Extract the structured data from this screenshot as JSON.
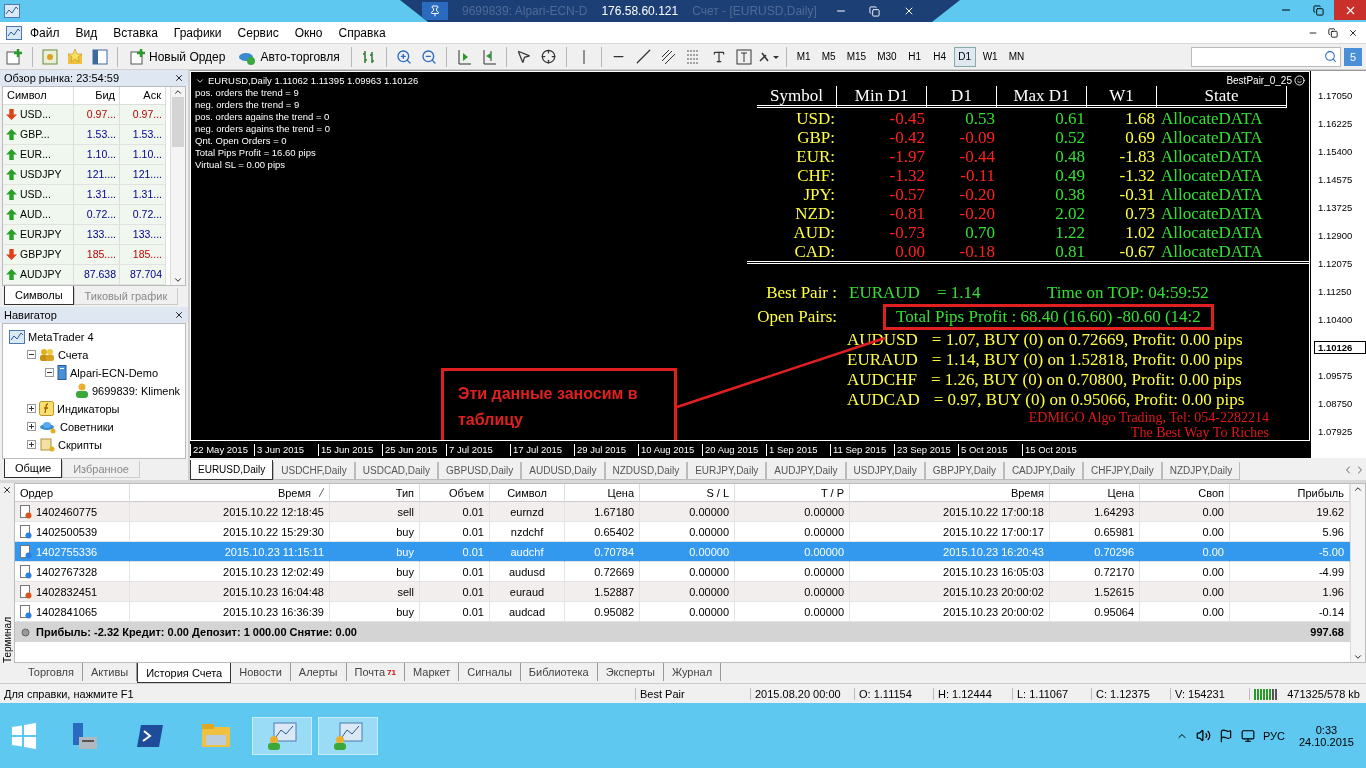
{
  "title_bar": {
    "title_left": "9699839: Alpari-ECN-D",
    "remote_host": "176.58.60.121",
    "title_right": "Счет - [EURUSD,Daily]"
  },
  "menu": [
    "Файл",
    "Вид",
    "Вставка",
    "Графики",
    "Сервис",
    "Окно",
    "Справка"
  ],
  "toolbar": {
    "new_order": "Новый Ордер",
    "auto_trading": "Авто-торговля",
    "timeframes": [
      {
        "label": "M1",
        "selected": false
      },
      {
        "label": "M5",
        "selected": false
      },
      {
        "label": "M15",
        "selected": false
      },
      {
        "label": "M30",
        "selected": false
      },
      {
        "label": "H1",
        "selected": false
      },
      {
        "label": "H4",
        "selected": false
      },
      {
        "label": "D1",
        "selected": true
      },
      {
        "label": "W1",
        "selected": false
      },
      {
        "label": "MN",
        "selected": false
      }
    ],
    "mail_count": "5"
  },
  "market_watch": {
    "title": "Обзор рынка: 23:54:59",
    "columns": [
      "Символ",
      "Бид",
      "Аск"
    ],
    "rows": [
      {
        "symbol": "USD...",
        "bid": "0.97...",
        "ask": "0.97...",
        "kind": "down"
      },
      {
        "symbol": "GBP...",
        "bid": "1.53...",
        "ask": "1.53...",
        "kind": "up"
      },
      {
        "symbol": "EUR...",
        "bid": "1.10...",
        "ask": "1.10...",
        "kind": "up"
      },
      {
        "symbol": "USDJPY",
        "bid": "121....",
        "ask": "121....",
        "kind": "up"
      },
      {
        "symbol": "USD...",
        "bid": "1.31...",
        "ask": "1.31...",
        "kind": "up"
      },
      {
        "symbol": "AUD...",
        "bid": "0.72...",
        "ask": "0.72...",
        "kind": "up"
      },
      {
        "symbol": "EURJPY",
        "bid": "133....",
        "ask": "133....",
        "kind": "up"
      },
      {
        "symbol": "GBPJPY",
        "bid": "185....",
        "ask": "185....",
        "kind": "down"
      },
      {
        "symbol": "AUDJPY",
        "bid": "87.638",
        "ask": "87.704",
        "kind": "up"
      }
    ],
    "tabs": [
      {
        "label": "Символы",
        "selected": true
      },
      {
        "label": "Тиковый график",
        "selected": false
      }
    ]
  },
  "navigator": {
    "title": "Навигатор",
    "tree": [
      {
        "label": "MetaTrader 4",
        "kind": "terminal",
        "children": [
          {
            "label": "Счета",
            "kind": "accounts",
            "expanded": true,
            "children": [
              {
                "label": "Alpari-ECN-Demo",
                "kind": "server",
                "expanded": true,
                "children": [
                  {
                    "label": "9699839: Klimenk",
                    "kind": "user"
                  }
                ]
              }
            ]
          },
          {
            "label": "Индикаторы",
            "kind": "indicators",
            "expanded": false
          },
          {
            "label": "Советники",
            "kind": "experts",
            "expanded": false
          },
          {
            "label": "Скрипты",
            "kind": "scripts",
            "expanded": false
          }
        ]
      }
    ],
    "tabs": [
      {
        "label": "Общие",
        "selected": true
      },
      {
        "label": "Избранное",
        "selected": false
      }
    ]
  },
  "chart": {
    "header": "EURUSD,Daily  1.11062 1.11395 1.09963 1.10126",
    "info_lines": [
      "pos. orders the trend = 9",
      "neg. orders the trend = 9",
      "pos. orders agains the trend = 0",
      "neg. orders agains the trend = 0",
      "Qnt. Open Orders = 0",
      "Total Pips Profit = 16.60 pips",
      "Virtual SL = 0.00 pips"
    ],
    "indicator_name": "BestPair_0_25",
    "table": {
      "columns": [
        "Symbol",
        "Min D1",
        "D1",
        "Max D1",
        "W1",
        "State"
      ],
      "rows": [
        {
          "symbol": "USD:",
          "cells": [
            {
              "text": "-0.45",
              "color": "#ff2020"
            },
            {
              "text": "0.53",
              "color": "#32e032"
            },
            {
              "text": "0.61",
              "color": "#32e032"
            },
            {
              "text": "1.68",
              "color": "#ffff40"
            },
            {
              "text": "AllocateDATA",
              "color": "#32e032"
            }
          ]
        },
        {
          "symbol": "GBP:",
          "cells": [
            {
              "text": "-0.42",
              "color": "#ff2020"
            },
            {
              "text": "-0.09",
              "color": "#ff2020"
            },
            {
              "text": "0.52",
              "color": "#32e032"
            },
            {
              "text": "0.69",
              "color": "#ffff40"
            },
            {
              "text": "AllocateDATA",
              "color": "#32e032"
            }
          ]
        },
        {
          "symbol": "EUR:",
          "cells": [
            {
              "text": "-1.97",
              "color": "#ff2020"
            },
            {
              "text": "-0.44",
              "color": "#ff2020"
            },
            {
              "text": "0.48",
              "color": "#32e032"
            },
            {
              "text": "-1.83",
              "color": "#ffff40"
            },
            {
              "text": "AllocateDATA",
              "color": "#32e032"
            }
          ]
        },
        {
          "symbol": "CHF:",
          "cells": [
            {
              "text": "-1.32",
              "color": "#ff2020"
            },
            {
              "text": "-0.11",
              "color": "#ff2020"
            },
            {
              "text": "0.49",
              "color": "#32e032"
            },
            {
              "text": "-1.32",
              "color": "#ffff40"
            },
            {
              "text": "AllocateDATA",
              "color": "#32e032"
            }
          ]
        },
        {
          "symbol": "JPY:",
          "cells": [
            {
              "text": "-0.57",
              "color": "#ff2020"
            },
            {
              "text": "-0.20",
              "color": "#ff2020"
            },
            {
              "text": "0.38",
              "color": "#32e032"
            },
            {
              "text": "-0.31",
              "color": "#ffff40"
            },
            {
              "text": "AllocateDATA",
              "color": "#32e032"
            }
          ]
        },
        {
          "symbol": "NZD:",
          "cells": [
            {
              "text": "-0.81",
              "color": "#ff2020"
            },
            {
              "text": "-0.20",
              "color": "#ff2020"
            },
            {
              "text": "2.02",
              "color": "#32e032"
            },
            {
              "text": "0.73",
              "color": "#ffff40"
            },
            {
              "text": "AllocateDATA",
              "color": "#32e032"
            }
          ]
        },
        {
          "symbol": "AUD:",
          "cells": [
            {
              "text": "-0.73",
              "color": "#ff2020"
            },
            {
              "text": "0.70",
              "color": "#32e032"
            },
            {
              "text": "1.22",
              "color": "#32e032"
            },
            {
              "text": "1.02",
              "color": "#ffff40"
            },
            {
              "text": "AllocateDATA",
              "color": "#32e032"
            }
          ]
        },
        {
          "symbol": "CAD:",
          "cells": [
            {
              "text": "0.00",
              "color": "#ff2020"
            },
            {
              "text": "-0.18",
              "color": "#ff2020"
            },
            {
              "text": "0.81",
              "color": "#32e032"
            },
            {
              "text": "-0.67",
              "color": "#ffff40"
            },
            {
              "text": "AllocateDATA",
              "color": "#32e032"
            }
          ]
        }
      ]
    },
    "best_pair": {
      "label": "Best Pair :",
      "pair": "EURAUD",
      "value": "= 1.14",
      "time": "Time on TOP: 04:59:52"
    },
    "open_pairs": {
      "label": "Open Pairs:",
      "total": "Total Pips Profit : 68.40 (16.60) -80.60 (14:2",
      "positions": [
        {
          "pair": "AUDUSD",
          "details": "= 1.07, BUY (0) on 0.72669, Profit: 0.00 pips"
        },
        {
          "pair": "EURAUD",
          "details": "= 1.14, BUY (0) on 1.52818, Profit: 0.00 pips"
        },
        {
          "pair": "AUDCHF",
          "details": "= 1.26, BUY (0) on 0.70800, Profit: 0.00 pips"
        },
        {
          "pair": "AUDCAD",
          "details": "= 0.97, BUY (0) on 0.95066, Profit: 0.00 pips"
        }
      ]
    },
    "credits": [
      "EDMIGO Algo Trading, Tel: 054-2282214",
      "The Best Way To Riches"
    ],
    "annotation": "Эти данные заносим в таблицу",
    "price_axis": [
      {
        "text": "1.17050",
        "current": false
      },
      {
        "text": "1.16225",
        "current": false
      },
      {
        "text": "1.15400",
        "current": false
      },
      {
        "text": "1.14575",
        "current": false
      },
      {
        "text": "1.13725",
        "current": false
      },
      {
        "text": "1.12900",
        "current": false
      },
      {
        "text": "1.12075",
        "current": false
      },
      {
        "text": "1.11250",
        "current": false
      },
      {
        "text": "1.10400",
        "current": false
      },
      {
        "text": "1.10126",
        "current": true
      },
      {
        "text": "1.09575",
        "current": false
      },
      {
        "text": "1.08750",
        "current": false
      },
      {
        "text": "1.07925",
        "current": false
      }
    ],
    "date_axis": [
      "22 May 2015",
      "3 Jun 2015",
      "15 Jun 2015",
      "25 Jun 2015",
      "7 Jul 2015",
      "17 Jul 2015",
      "29 Jul 2015",
      "10 Aug 2015",
      "20 Aug 2015",
      "1 Sep 2015",
      "11 Sep 2015",
      "23 Sep 2015",
      "5 Oct 2015",
      "15 Oct 2015"
    ]
  },
  "chart_tabs": [
    {
      "label": "EURUSD,Daily",
      "selected": true
    },
    {
      "label": "USDCHF,Daily",
      "selected": false
    },
    {
      "label": "USDCAD,Daily",
      "selected": false
    },
    {
      "label": "GBPUSD,Daily",
      "selected": false
    },
    {
      "label": "AUDUSD,Daily",
      "selected": false
    },
    {
      "label": "NZDUSD,Daily",
      "selected": false
    },
    {
      "label": "EURJPY,Daily",
      "selected": false
    },
    {
      "label": "AUDJPY,Daily",
      "selected": false
    },
    {
      "label": "USDJPY,Daily",
      "selected": false
    },
    {
      "label": "GBPJPY,Daily",
      "selected": false
    },
    {
      "label": "CADJPY,Daily",
      "selected": false
    },
    {
      "label": "CHFJPY,Daily",
      "selected": false
    },
    {
      "label": "NZDJPY,Daily",
      "selected": false
    }
  ],
  "terminal": {
    "label": "Терминал",
    "columns": [
      {
        "label": "Ордер",
        "sorted": false
      },
      {
        "label": "Время",
        "sorted": true
      },
      {
        "label": "Тип",
        "sorted": false
      },
      {
        "label": "Объем",
        "sorted": false
      },
      {
        "label": "Символ",
        "sorted": false
      },
      {
        "label": "Цена",
        "sorted": false
      },
      {
        "label": "S / L",
        "sorted": false
      },
      {
        "label": "T / P",
        "sorted": false
      },
      {
        "label": "Время",
        "sorted": false
      },
      {
        "label": "Цена",
        "sorted": false
      },
      {
        "label": "Своп",
        "sorted": false
      },
      {
        "label": "Прибыль",
        "sorted": false
      }
    ],
    "rows": [
      {
        "kind": "sell",
        "selected": false,
        "cells": [
          "1402460775",
          "2015.10.22 12:18:45",
          "sell",
          "0.01",
          "eurnzd",
          "1.67180",
          "0.00000",
          "0.00000",
          "2015.10.22 17:00:18",
          "1.64293",
          "0.00",
          "19.62"
        ]
      },
      {
        "kind": "buy",
        "selected": false,
        "cells": [
          "1402500539",
          "2015.10.22 15:29:30",
          "buy",
          "0.01",
          "nzdchf",
          "0.65402",
          "0.00000",
          "0.00000",
          "2015.10.22 17:00:17",
          "0.65981",
          "0.00",
          "5.96"
        ]
      },
      {
        "kind": "buy",
        "selected": true,
        "cells": [
          "1402755336",
          "2015.10.23 11:15:11",
          "buy",
          "0.01",
          "audchf",
          "0.70784",
          "0.00000",
          "0.00000",
          "2015.10.23 16:20:43",
          "0.70296",
          "0.00",
          "-5.00"
        ]
      },
      {
        "kind": "buy",
        "selected": false,
        "cells": [
          "1402767328",
          "2015.10.23 12:02:49",
          "buy",
          "0.01",
          "audusd",
          "0.72669",
          "0.00000",
          "0.00000",
          "2015.10.23 16:05:03",
          "0.72170",
          "0.00",
          "-4.99"
        ]
      },
      {
        "kind": "sell",
        "selected": false,
        "cells": [
          "1402832451",
          "2015.10.23 16:04:48",
          "sell",
          "0.01",
          "euraud",
          "1.52887",
          "0.00000",
          "0.00000",
          "2015.10.23 20:00:02",
          "1.52615",
          "0.00",
          "1.96"
        ]
      },
      {
        "kind": "buy",
        "selected": false,
        "cells": [
          "1402841065",
          "2015.10.23 16:36:39",
          "buy",
          "0.01",
          "audcad",
          "0.95082",
          "0.00000",
          "0.00000",
          "2015.10.23 20:00:02",
          "0.95064",
          "0.00",
          "-0.14"
        ]
      }
    ],
    "summary": "Прибыль: -2.32  Кредит: 0.00  Депозит: 1 000.00  Снятие: 0.00",
    "balance": "997.68",
    "tabs": [
      {
        "label": "Торговля",
        "selected": false
      },
      {
        "label": "Активы",
        "selected": false
      },
      {
        "label": "История Счета",
        "selected": true
      },
      {
        "label": "Новости",
        "selected": false
      },
      {
        "label": "Алерты",
        "selected": false
      },
      {
        "label": "Почта",
        "selected": false,
        "badge": "71"
      },
      {
        "label": "Маркет",
        "selected": false
      },
      {
        "label": "Сигналы",
        "selected": false
      },
      {
        "label": "Библиотека",
        "selected": false
      },
      {
        "label": "Эксперты",
        "selected": false
      },
      {
        "label": "Журнал",
        "selected": false
      }
    ]
  },
  "status_bar": {
    "help": "Для справки, нажмите F1",
    "profile": "Best Pair",
    "cells": [
      "2015.08.20 00:00",
      "O: 1.11154",
      "H: 1.12444",
      "L: 1.11067",
      "C: 1.12375",
      "V: 154231"
    ],
    "traffic": "471325/578 kb"
  },
  "taskbar": {
    "apps": [
      {
        "kind": "server",
        "running": false
      },
      {
        "kind": "shell",
        "running": false
      },
      {
        "kind": "folder",
        "running": false
      },
      {
        "kind": "trader",
        "running": true
      },
      {
        "kind": "trader",
        "running": true
      }
    ],
    "language": "РУС",
    "time": "0:33",
    "date": "24.10.2015"
  }
}
